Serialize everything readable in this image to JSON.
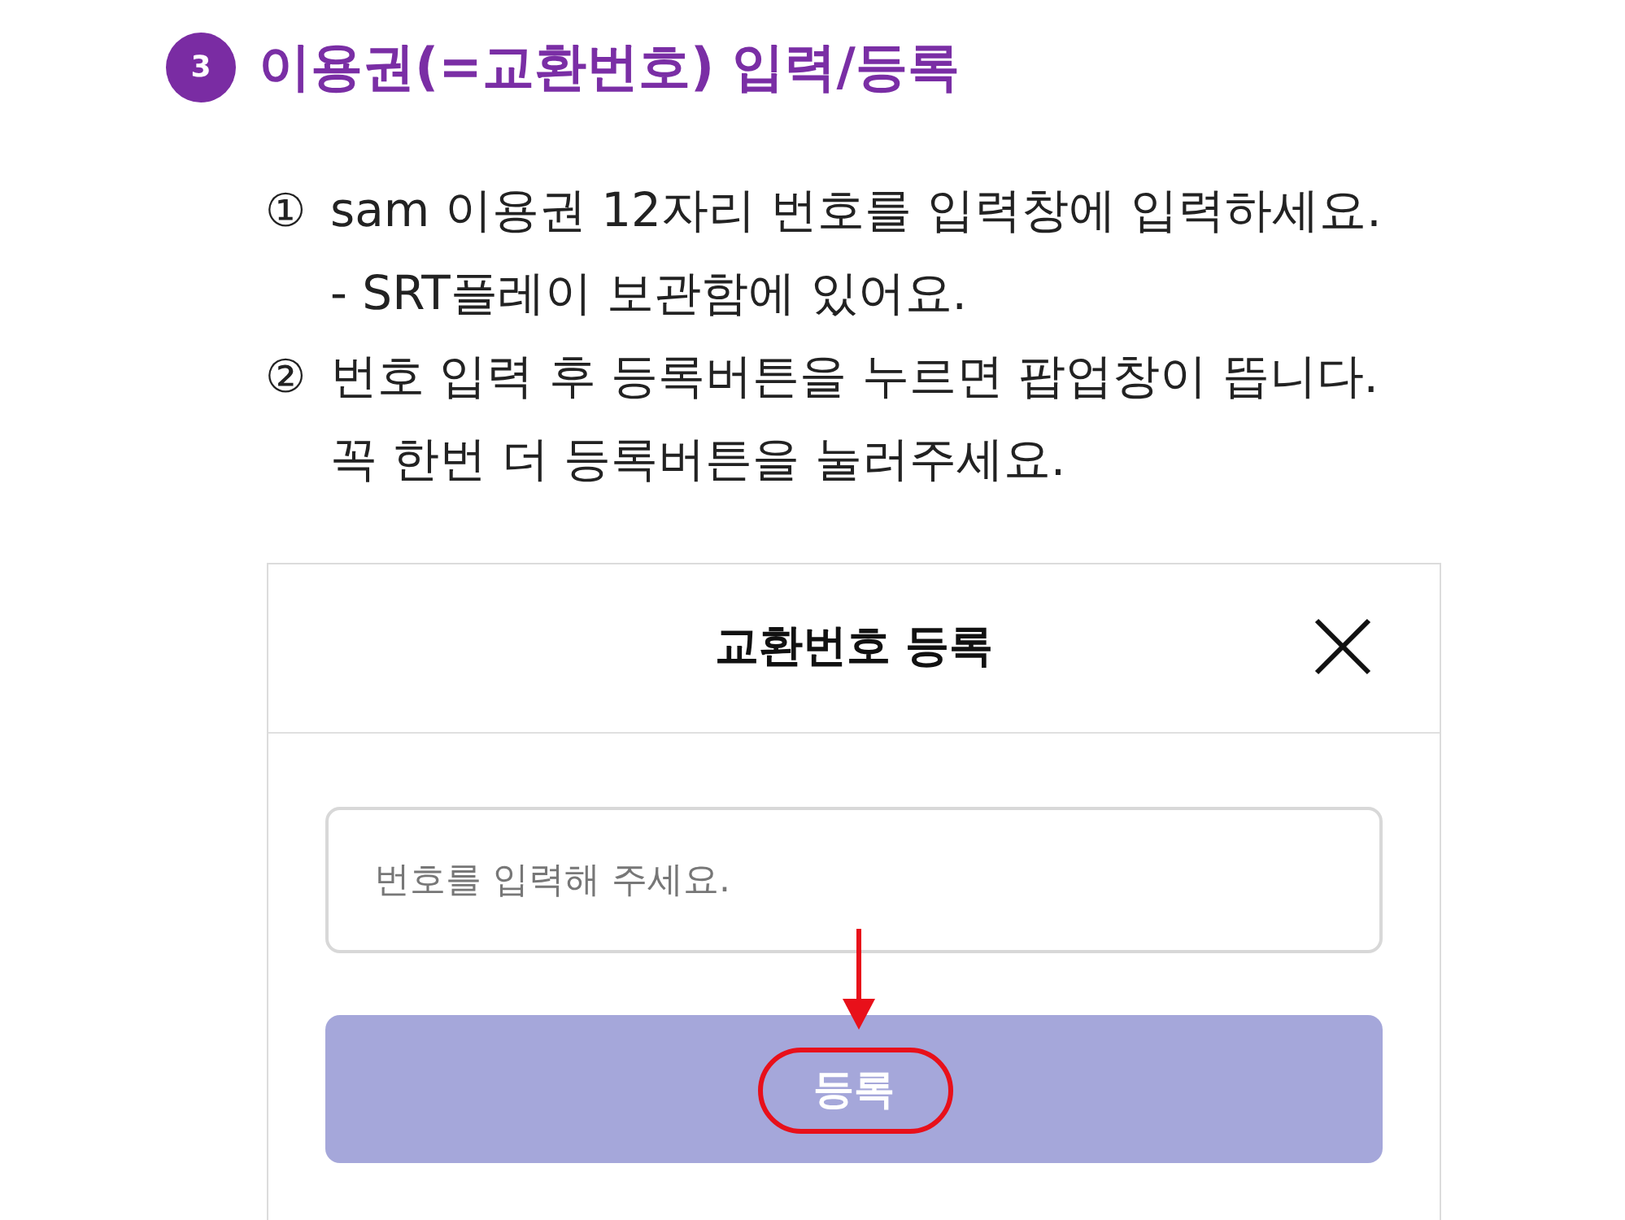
{
  "heading": {
    "number": "3",
    "title": "이용권(=교환번호) 입력/등록"
  },
  "steps": [
    {
      "marker": "①",
      "lines": [
        "sam 이용권 12자리 번호를 입력창에 입력하세요.",
        "- SRT플레이 보관함에 있어요."
      ]
    },
    {
      "marker": "②",
      "lines": [
        "번호 입력 후 등록버튼을 누르면 팝업창이 뜹니다.",
        "꼭 한번 더 등록버튼을 눌러주세요."
      ]
    }
  ],
  "dialog": {
    "title": "교환번호 등록",
    "input": {
      "placeholder": "번호를 입력해 주세요."
    },
    "submit_button": {
      "label": "등록",
      "highlighted": true
    }
  }
}
